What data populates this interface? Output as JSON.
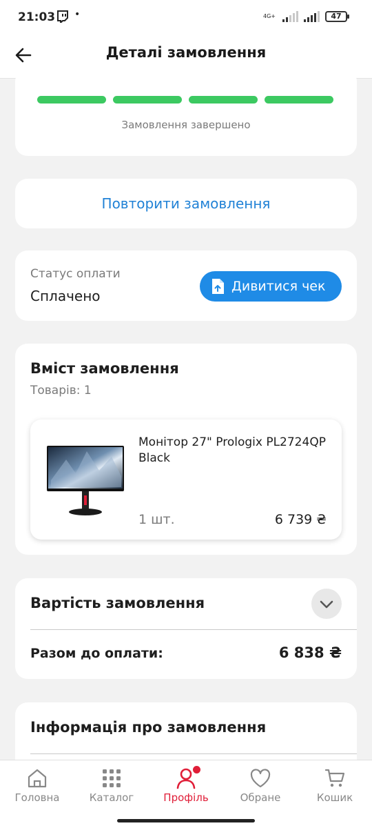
{
  "status_bar": {
    "time": "21:03",
    "network": "4G+",
    "battery": "47"
  },
  "header": {
    "title": "Деталі замовлення"
  },
  "progress": {
    "steps_total": 4,
    "steps_done": 4,
    "status_text": "Замовлення завершено",
    "color": "#3cc961"
  },
  "repeat": {
    "label": "Повторити замовлення"
  },
  "payment": {
    "label": "Статус оплати",
    "value": "Сплачено",
    "receipt_button": "Дивитися чек"
  },
  "order_items": {
    "title": "Вміст замовлення",
    "count": "Товарів: 1",
    "products": [
      {
        "name": "Монітор 27\" Prologix PL2724QP Black",
        "qty": "1 шт.",
        "price": "6 739 ₴"
      }
    ]
  },
  "cost": {
    "title": "Вартість замовлення",
    "total_label": "Разом до оплати:",
    "total_value": "6 838 ₴"
  },
  "info": {
    "title": "Інформація про замовлення"
  },
  "bottom_nav": {
    "items": [
      {
        "label": "Головна",
        "icon": "home-icon"
      },
      {
        "label": "Каталог",
        "icon": "grid-icon"
      },
      {
        "label": "Профіль",
        "icon": "profile-icon"
      },
      {
        "label": "Обране",
        "icon": "heart-icon"
      },
      {
        "label": "Кошик",
        "icon": "cart-icon"
      }
    ],
    "active_index": 2,
    "accent": "#e01e38"
  },
  "colors": {
    "link": "#2182d6",
    "button": "#1f8be6"
  }
}
